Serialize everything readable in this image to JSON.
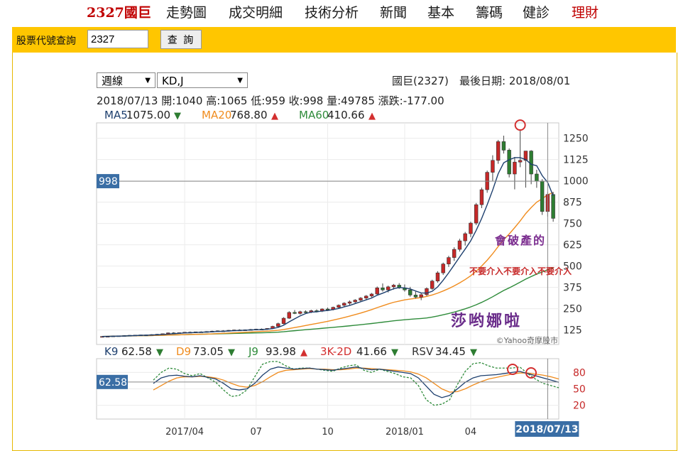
{
  "nav": {
    "stock_title": "2327國巨",
    "items": [
      "走勢圖",
      "成交明細",
      "技術分析",
      "新聞",
      "基本",
      "籌碼",
      "健診"
    ],
    "finance": "理財"
  },
  "query": {
    "label": "股票代號查詢",
    "value": "2327",
    "button": "查 詢"
  },
  "controls": {
    "period": "週線",
    "indicator": "KD,J"
  },
  "info": {
    "stock_name": "國巨(2327)",
    "last_date": "最後日期: 2018/08/01",
    "ohlc_line": "2018/07/13 開:1040 高:1065 低:959 收:998 量:49785 漲跌:-177.00"
  },
  "ma_legend": [
    {
      "label": "MA5",
      "value": "1075.00",
      "arrow": "▼",
      "color": "#1d3f6e",
      "arrow_color": "#2e7d32"
    },
    {
      "label": "MA20",
      "value": "768.80",
      "arrow": "▲",
      "color": "#f08c1e",
      "arrow_color": "#d32f2f"
    },
    {
      "label": "MA60",
      "value": "410.66",
      "arrow": "▲",
      "color": "#2e8b3a",
      "arrow_color": "#d32f2f"
    }
  ],
  "kd_legend": [
    {
      "label": "K9",
      "value": "62.58",
      "arrow": "▼",
      "color": "#1d3f6e",
      "arrow_color": "#2e7d32"
    },
    {
      "label": "D9",
      "value": "73.05",
      "arrow": "▼",
      "color": "#f08c1e",
      "arrow_color": "#2e7d32"
    },
    {
      "label": "J9",
      "value": "93.98",
      "arrow": "▲",
      "color": "#2e8b3a",
      "arrow_color": "#d32f2f"
    },
    {
      "label": "3K-2D",
      "value": "41.66",
      "arrow": "▼",
      "color": "#d32f2f",
      "arrow_color": "#2e7d32"
    },
    {
      "label": "RSV",
      "value": "34.45",
      "arrow": "▼",
      "color": "#333333",
      "arrow_color": "#2e7d32"
    }
  ],
  "annotations": {
    "bankrupt": "會破產的",
    "dont_intervene": "不要介入不要介入不要介入",
    "signature": "莎哟娜啦",
    "watermark": "©Yahoo奇摩股市"
  },
  "chart_data": {
    "type": "candlestick",
    "price_axis_ticks": [
      125,
      250,
      375,
      500,
      625,
      750,
      875,
      1000,
      1125,
      1250
    ],
    "kd_axis_ticks": [
      20,
      50,
      80
    ],
    "x_tick_labels": [
      {
        "label": "2017/04",
        "i": 15
      },
      {
        "label": "07",
        "i": 28
      },
      {
        "label": "10",
        "i": 41
      },
      {
        "label": "2018/01",
        "i": 55
      },
      {
        "label": "04",
        "i": 67
      }
    ],
    "crosshair": {
      "price": 998,
      "date": "2018/07/13",
      "kd_value": 62.58,
      "i": 81
    },
    "current_price_label": "998",
    "current_kd_label": "62.58",
    "candles": [
      [
        86,
        88,
        84,
        87
      ],
      [
        87,
        90,
        85,
        88
      ],
      [
        88,
        92,
        86,
        90
      ],
      [
        90,
        92,
        88,
        91
      ],
      [
        91,
        94,
        89,
        92
      ],
      [
        92,
        95,
        90,
        94
      ],
      [
        94,
        96,
        92,
        95
      ],
      [
        95,
        97,
        93,
        96
      ],
      [
        96,
        98,
        94,
        95
      ],
      [
        95,
        100,
        93,
        98
      ],
      [
        98,
        102,
        96,
        100
      ],
      [
        100,
        104,
        98,
        103
      ],
      [
        103,
        110,
        100,
        108
      ],
      [
        108,
        112,
        104,
        106
      ],
      [
        106,
        110,
        103,
        109
      ],
      [
        109,
        113,
        106,
        112
      ],
      [
        112,
        116,
        108,
        110
      ],
      [
        110,
        115,
        107,
        114
      ],
      [
        114,
        117,
        110,
        113
      ],
      [
        113,
        118,
        110,
        116
      ],
      [
        116,
        121,
        112,
        118
      ],
      [
        118,
        122,
        114,
        120
      ],
      [
        120,
        124,
        116,
        119
      ],
      [
        119,
        125,
        116,
        123
      ],
      [
        123,
        127,
        119,
        125
      ],
      [
        125,
        129,
        121,
        124
      ],
      [
        124,
        128,
        120,
        126
      ],
      [
        126,
        131,
        122,
        128
      ],
      [
        128,
        132,
        124,
        130
      ],
      [
        130,
        134,
        125,
        129
      ],
      [
        129,
        136,
        126,
        134
      ],
      [
        134,
        150,
        130,
        146
      ],
      [
        146,
        168,
        142,
        162
      ],
      [
        162,
        200,
        158,
        194
      ],
      [
        194,
        235,
        190,
        228
      ],
      [
        228,
        242,
        218,
        222
      ],
      [
        222,
        238,
        215,
        232
      ],
      [
        232,
        240,
        222,
        230
      ],
      [
        230,
        244,
        224,
        238
      ],
      [
        238,
        246,
        228,
        235
      ],
      [
        235,
        252,
        230,
        248
      ],
      [
        248,
        256,
        240,
        245
      ],
      [
        245,
        262,
        240,
        258
      ],
      [
        258,
        275,
        250,
        270
      ],
      [
        270,
        288,
        262,
        282
      ],
      [
        282,
        298,
        272,
        290
      ],
      [
        290,
        306,
        280,
        300
      ],
      [
        300,
        318,
        292,
        312
      ],
      [
        312,
        330,
        300,
        324
      ],
      [
        324,
        342,
        316,
        336
      ],
      [
        336,
        380,
        330,
        372
      ],
      [
        372,
        398,
        350,
        360
      ],
      [
        360,
        385,
        345,
        378
      ],
      [
        378,
        395,
        362,
        388
      ],
      [
        388,
        400,
        366,
        372
      ],
      [
        372,
        392,
        350,
        360
      ],
      [
        360,
        378,
        320,
        330
      ],
      [
        330,
        350,
        310,
        318
      ],
      [
        318,
        340,
        300,
        332
      ],
      [
        332,
        375,
        325,
        368
      ],
      [
        368,
        420,
        360,
        412
      ],
      [
        412,
        470,
        402,
        460
      ],
      [
        460,
        520,
        448,
        512
      ],
      [
        512,
        560,
        495,
        550
      ],
      [
        550,
        610,
        530,
        598
      ],
      [
        598,
        660,
        585,
        648
      ],
      [
        648,
        700,
        620,
        690
      ],
      [
        690,
        760,
        670,
        752
      ],
      [
        752,
        870,
        740,
        860
      ],
      [
        860,
        960,
        840,
        948
      ],
      [
        948,
        1060,
        930,
        1050
      ],
      [
        1050,
        1150,
        1000,
        1120
      ],
      [
        1120,
        1240,
        1100,
        1230
      ],
      [
        1230,
        1265,
        1160,
        1180
      ],
      [
        1180,
        1190,
        1020,
        1040
      ],
      [
        1040,
        1140,
        950,
        1110
      ],
      [
        1110,
        1302,
        1080,
        1120
      ],
      [
        1120,
        1160,
        960,
        1175
      ],
      [
        1175,
        1180,
        980,
        1040
      ],
      [
        1040,
        1065,
        959,
        998
      ],
      [
        998,
        1010,
        800,
        820
      ],
      [
        820,
        935,
        790,
        920
      ],
      [
        920,
        935,
        760,
        780
      ]
    ],
    "ma5_last": 1075.0,
    "ma20_last": 768.8,
    "ma60_last": 410.66,
    "k_series": [
      60,
      70,
      74,
      75,
      73,
      72,
      74,
      71,
      68,
      60,
      50,
      48,
      50,
      60,
      75,
      86,
      90,
      88,
      86,
      87,
      88,
      86,
      85,
      84,
      86,
      88,
      90,
      87,
      85,
      86,
      84,
      82,
      80,
      78,
      70,
      55,
      40,
      34,
      38,
      50,
      62,
      70,
      74,
      75,
      76,
      78,
      80,
      82,
      78,
      74,
      70,
      66,
      62
    ],
    "d_series": [
      48,
      56,
      64,
      70,
      72,
      72,
      73,
      72,
      70,
      66,
      60,
      55,
      53,
      56,
      63,
      72,
      80,
      84,
      85,
      86,
      87,
      86,
      86,
      85,
      85,
      86,
      88,
      88,
      87,
      86,
      85,
      84,
      83,
      81,
      77,
      70,
      60,
      50,
      44,
      45,
      50,
      57,
      63,
      68,
      71,
      74,
      77,
      79,
      79,
      77,
      75,
      72,
      68
    ],
    "j_series": [
      66,
      80,
      88,
      86,
      78,
      74,
      78,
      70,
      62,
      48,
      36,
      38,
      48,
      72,
      95,
      100,
      100,
      92,
      86,
      88,
      88,
      86,
      84,
      82,
      88,
      92,
      94,
      84,
      80,
      86,
      82,
      78,
      72,
      70,
      56,
      30,
      20,
      22,
      30,
      58,
      82,
      96,
      98,
      92,
      88,
      88,
      88,
      90,
      78,
      68,
      60,
      56,
      52
    ]
  }
}
